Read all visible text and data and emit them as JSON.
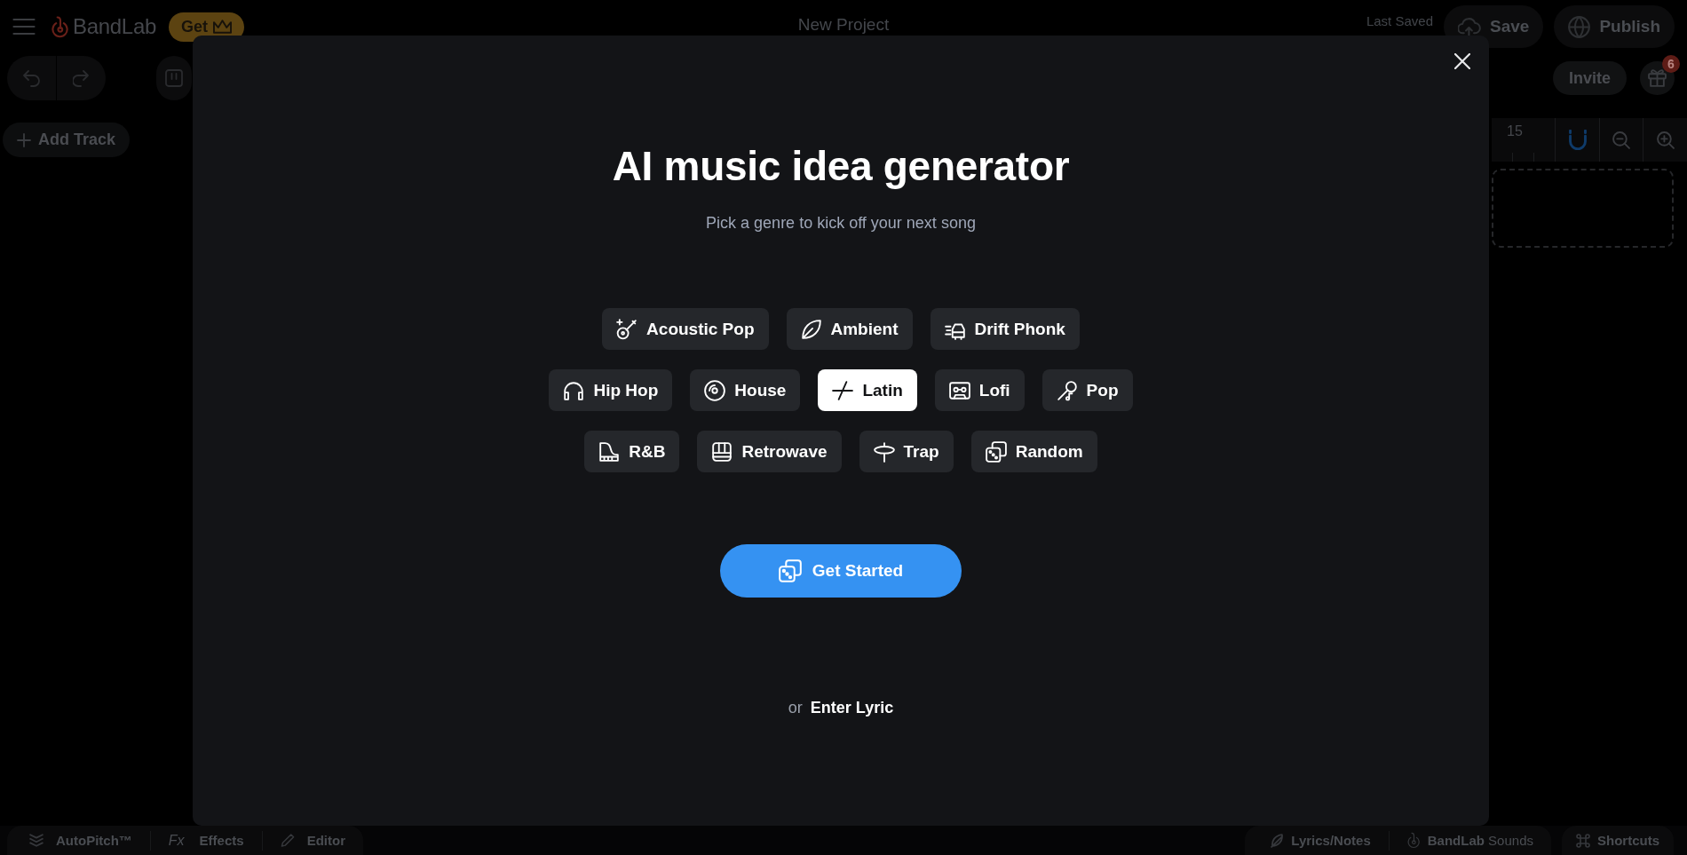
{
  "header": {
    "brand": "BandLab",
    "upgrade_button": "Get",
    "project_title": "New Project",
    "last_saved_label": "Last Saved",
    "save_button": "Save",
    "publish_button": "Publish"
  },
  "toolbar": {
    "invite_button": "Invite",
    "gift_badge": "6"
  },
  "workspace": {
    "add_track_button": "Add Track",
    "ruler_label": "15",
    "snap_on": true
  },
  "modal": {
    "title": "AI music idea generator",
    "subtitle": "Pick a genre to kick off your next song",
    "genre_rows": [
      {
        "genres": [
          {
            "label": "Acoustic Pop",
            "selected": false
          },
          {
            "label": "Ambient",
            "selected": false
          },
          {
            "label": "Drift Phonk",
            "selected": false
          }
        ]
      },
      {
        "genres": [
          {
            "label": "Hip Hop",
            "selected": false
          },
          {
            "label": "House",
            "selected": false
          },
          {
            "label": "Latin",
            "selected": true
          },
          {
            "label": "Lofi",
            "selected": false
          },
          {
            "label": "Pop",
            "selected": false
          }
        ]
      },
      {
        "genres": [
          {
            "label": "R&B",
            "selected": false
          },
          {
            "label": "Retrowave",
            "selected": false
          },
          {
            "label": "Trap",
            "selected": false
          },
          {
            "label": "Random",
            "selected": false
          }
        ]
      }
    ],
    "get_started_button": "Get Started",
    "alternative_prefix": "or",
    "enter_lyric_link": "Enter Lyric"
  },
  "bottom_bar": {
    "left_tools": [
      {
        "label": "AutoPitch™"
      },
      {
        "symbol": "Fx",
        "label": "Effects"
      },
      {
        "label": "Editor"
      }
    ],
    "right_tools": [
      {
        "label": "Lyrics/Notes"
      },
      {
        "label": "**BandLab** Sounds"
      }
    ],
    "shortcuts_button": "Shortcuts"
  }
}
